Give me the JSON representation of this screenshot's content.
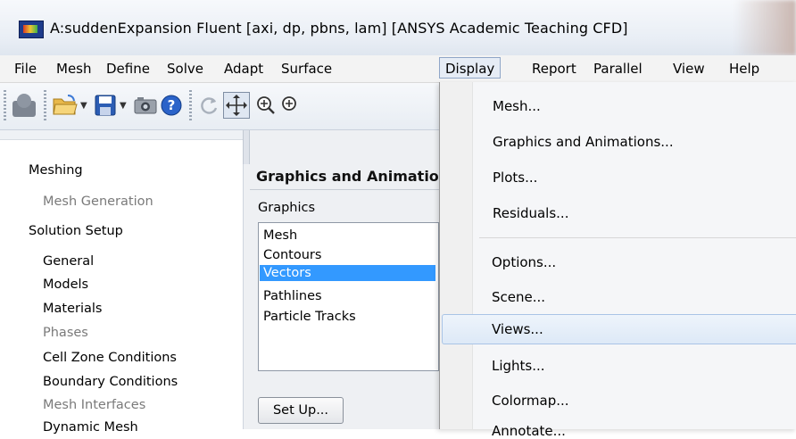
{
  "window": {
    "title": "A:suddenExpansion Fluent  [axi, dp, pbns, lam] [ANSYS Academic Teaching CFD]"
  },
  "menubar": {
    "items": [
      "File",
      "Mesh",
      "Define",
      "Solve",
      "Adapt",
      "Surface",
      "Display",
      "Report",
      "Parallel",
      "View",
      "Help"
    ],
    "open_item": "Display"
  },
  "toolbar": {
    "icons": [
      "app-icon",
      "open-folder-icon",
      "save-icon",
      "screenshot-icon",
      "help-icon",
      "rotate-icon",
      "translate-icon",
      "zoom-in-icon",
      "zoom-icon"
    ]
  },
  "nav": {
    "items": [
      {
        "label": "Meshing",
        "level": 0,
        "dim": false
      },
      {
        "label": "Mesh Generation",
        "level": 1,
        "dim": true
      },
      {
        "label": "Solution Setup",
        "level": 0,
        "dim": false
      },
      {
        "label": "General",
        "level": 1,
        "dim": false
      },
      {
        "label": "Models",
        "level": 1,
        "dim": false
      },
      {
        "label": "Materials",
        "level": 1,
        "dim": false
      },
      {
        "label": "Phases",
        "level": 1,
        "dim": true
      },
      {
        "label": "Cell Zone Conditions",
        "level": 1,
        "dim": false
      },
      {
        "label": "Boundary Conditions",
        "level": 1,
        "dim": false
      },
      {
        "label": "Mesh Interfaces",
        "level": 1,
        "dim": true
      },
      {
        "label": "Dynamic Mesh",
        "level": 1,
        "dim": false
      }
    ]
  },
  "task": {
    "title": "Graphics and Animations",
    "graphics_label": "Graphics",
    "list": [
      "Mesh",
      "Contours",
      "Vectors",
      "Pathlines",
      "Particle Tracks"
    ],
    "selected": "Vectors",
    "setup_label": "Set Up..."
  },
  "display_menu": {
    "group1": [
      "Mesh...",
      "Graphics and Animations...",
      "Plots...",
      "Residuals..."
    ],
    "group2": [
      "Options...",
      "Scene...",
      "Views...",
      "Lights...",
      "Colormap...",
      "Annotate..."
    ],
    "hovered": "Views..."
  },
  "colors": {
    "selection": "#3399ff",
    "menu_highlight": "#dde9f7",
    "dim_text": "#7a7a7a"
  }
}
